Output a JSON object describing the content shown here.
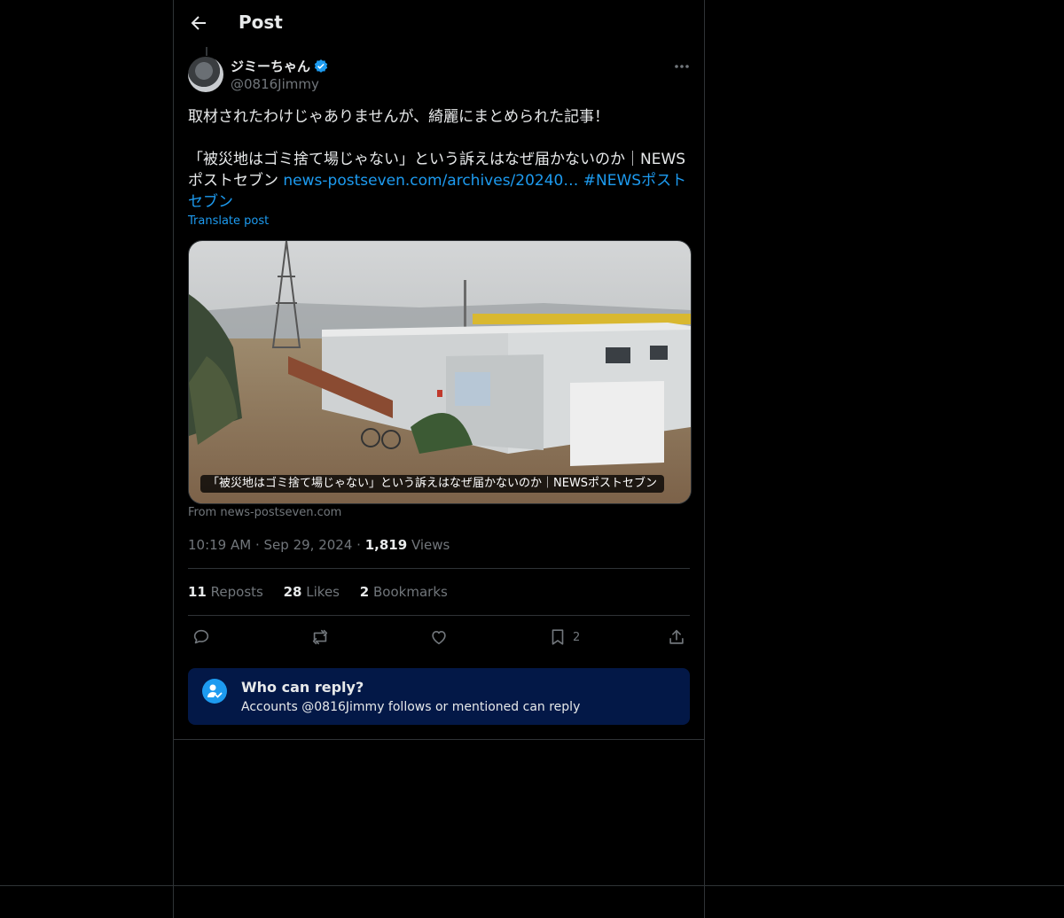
{
  "header": {
    "title": "Post"
  },
  "post": {
    "author_name": "ジミーちゃん",
    "author_handle": "@0816Jimmy",
    "text_line1": "取材されたわけじゃありませんが、綺麗にまとめられた記事！",
    "text_line2": "「被災地はゴミ捨て場じゃない」という訴えはなぜ届かないのか｜NEWSポストセブン ",
    "link_text": "news-postseven.com/archives/20240…",
    "hashtag": " #NEWSポストセブン",
    "translate_label": "Translate post",
    "card_caption": "「被災地はゴミ捨て場じゃない」という訴えはなぜ届かないのか｜NEWSポストセブン",
    "card_source": "From news-postseven.com",
    "time": "10:19 AM",
    "date": "Sep 29, 2024",
    "views_count": "1,819",
    "views_label": "Views",
    "reposts_count": "11",
    "reposts_label": "Reposts",
    "likes_count": "28",
    "likes_label": "Likes",
    "bookmarks_count": "2",
    "bookmarks_label": "Bookmarks",
    "bookmark_action_count": "2"
  },
  "reply_restriction": {
    "title": "Who can reply?",
    "subtitle": "Accounts @0816Jimmy follows or mentioned can reply"
  },
  "colors": {
    "accent": "#1d9bf0",
    "background": "#000000",
    "muted": "#71767b",
    "reply_box": "#031847"
  },
  "icons": [
    "back-arrow-icon",
    "verified-badge-icon",
    "more-icon",
    "reply-icon",
    "repost-icon",
    "like-icon",
    "bookmark-icon",
    "share-icon",
    "person-check-icon"
  ]
}
